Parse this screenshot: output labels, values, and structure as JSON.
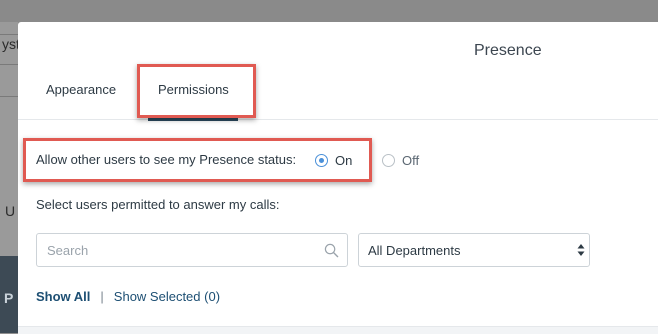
{
  "background": {
    "fragment_top": "yst",
    "fragment_mid": "U",
    "fragment_bottom": "P"
  },
  "modal": {
    "title": "Presence"
  },
  "tabs": [
    {
      "label": "Appearance",
      "active": false
    },
    {
      "label": "Permissions",
      "active": true
    }
  ],
  "presence": {
    "label": "Allow other users to see my Presence status:",
    "options": [
      {
        "label": "On",
        "checked": true
      },
      {
        "label": "Off",
        "checked": false
      }
    ]
  },
  "answer_calls": {
    "label": "Select users permitted to answer my calls:"
  },
  "search": {
    "placeholder": "Search",
    "value": ""
  },
  "department": {
    "selected": "All Departments"
  },
  "filters": {
    "show_all": "Show All",
    "separator": "|",
    "show_selected": "Show Selected (0)"
  },
  "colors": {
    "accent": "#4a90d9",
    "link": "#1d4f73",
    "highlight": "#e05a52",
    "tab_underline": "#2c4a5e"
  }
}
